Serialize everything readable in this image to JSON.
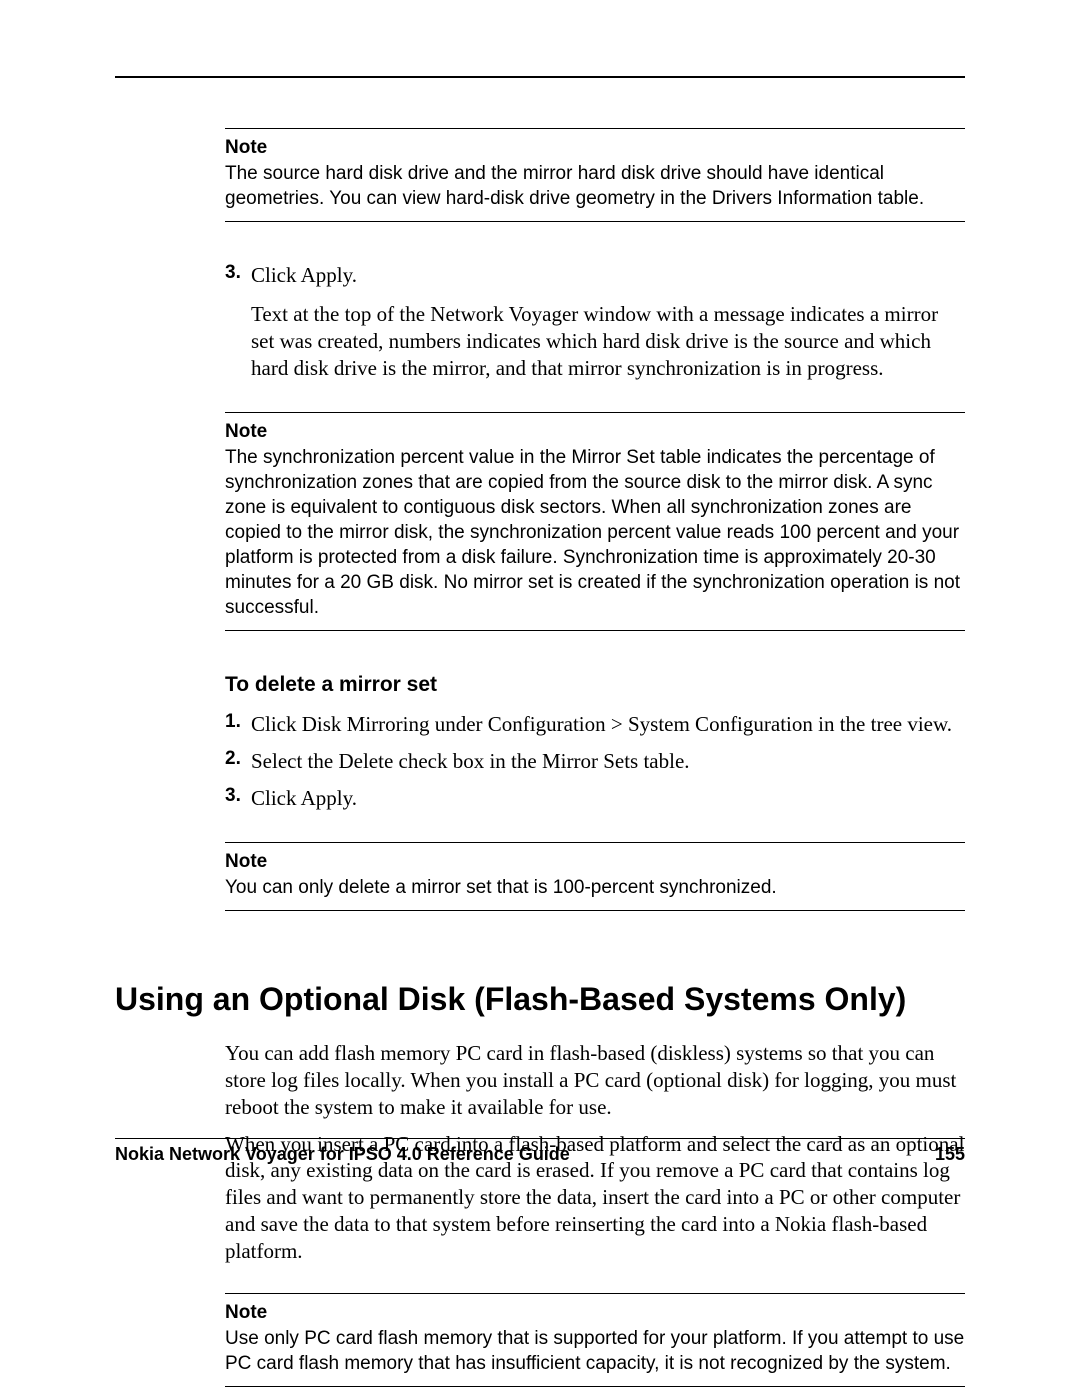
{
  "note_label": "Note",
  "notes": {
    "n1": "The source hard disk drive and the mirror hard disk drive should have identical geometries. You can view hard-disk drive geometry in the Drivers Information table.",
    "n2": "The synchronization percent value in the Mirror Set table indicates the percentage of synchronization zones that are copied from the source disk to the mirror disk. A sync zone is equivalent to contiguous disk sectors. When all synchronization zones are copied to the mirror disk, the synchronization percent value reads 100 percent and your platform is protected from a disk failure. Synchronization time is approximately 20-30 minutes for a 20 GB disk. No mirror set is created if the synchronization operation is not successful.",
    "n3": "You can only delete a mirror set that is 100-percent synchronized.",
    "n4": "Use only PC card flash memory that is supported for your platform. If you attempt to use PC card flash memory that has insufficient capacity, it is not recognized by the system."
  },
  "steps_a": {
    "num3": "3.",
    "t3": "Click Apply.",
    "t3_para": "Text at the top of the Network Voyager window with a message indicates a mirror set was created, numbers indicates which hard disk drive is the source and which hard disk drive is the mirror, and that mirror synchronization is in progress."
  },
  "delete": {
    "heading": "To delete a mirror set",
    "num1": "1.",
    "t1": "Click Disk Mirroring under Configuration > System Configuration in the tree view.",
    "num2": "2.",
    "t2": "Select the Delete check box in the Mirror Sets table.",
    "num3": "3.",
    "t3": "Click Apply."
  },
  "section": {
    "heading": "Using an Optional Disk (Flash-Based Systems Only)",
    "p1": "You can add flash memory PC card in flash-based (diskless) systems so that you can store log files locally. When you install a PC card (optional disk) for logging, you must reboot the system to make it available for use.",
    "p2": "When you insert a PC card into a flash-based platform and select the card as an optional disk, any existing data on the card is erased. If you remove a PC card that contains log files and want to permanently store the data, insert the card into a PC or other computer and save the data to that system before reinserting the card into a Nokia flash-based platform."
  },
  "footer": {
    "title": "Nokia Network Voyager for IPSO 4.0 Reference Guide",
    "page": "155"
  }
}
